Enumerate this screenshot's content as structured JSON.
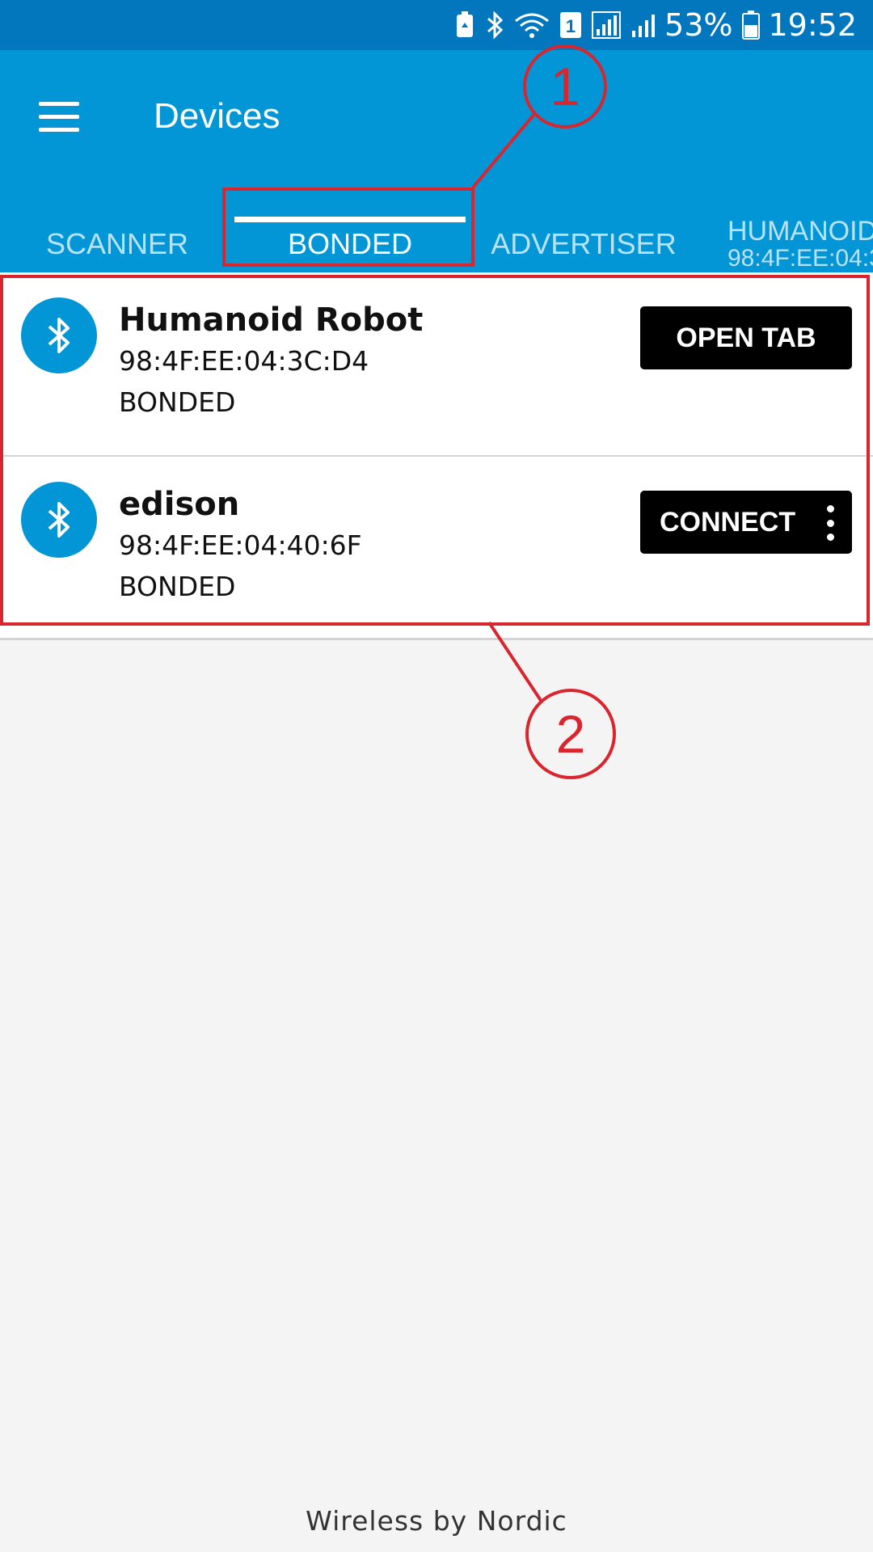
{
  "status_bar": {
    "battery_percent": "53%",
    "time": "19:52",
    "sim_label": "1",
    "icons": [
      "battery-saver-icon",
      "bluetooth-icon",
      "wifi-icon",
      "sim-icon",
      "signal-icon",
      "signal-icon",
      "battery-icon"
    ]
  },
  "app_bar": {
    "title": "Devices",
    "menu_icon": "hamburger-menu-icon"
  },
  "tabs": [
    {
      "label": "SCANNER",
      "active": false
    },
    {
      "label": "BONDED",
      "active": true
    },
    {
      "label": "ADVERTISER",
      "active": false
    },
    {
      "label": "HUMANOID",
      "sublabel": "98:4F:EE:04:3",
      "active": false
    }
  ],
  "devices": [
    {
      "name": "Humanoid Robot",
      "address": "98:4F:EE:04:3C:D4",
      "state": "BONDED",
      "action": "OPEN TAB",
      "icon": "bluetooth-icon"
    },
    {
      "name": "edison",
      "address": "98:4F:EE:04:40:6F",
      "state": "BONDED",
      "action": "CONNECT",
      "icon": "bluetooth-icon",
      "more_icon": "more-vertical-icon"
    }
  ],
  "footer": {
    "text": "Wireless by Nordic"
  },
  "annotations": [
    {
      "label": "1",
      "color": "#d9262e"
    },
    {
      "label": "2",
      "color": "#d9262e"
    }
  ],
  "colors": {
    "status_bar": "#0277bd",
    "app_bar": "#0296d6",
    "background": "#f4f4f4",
    "annotation": "#d9262e",
    "button": "#000000"
  }
}
